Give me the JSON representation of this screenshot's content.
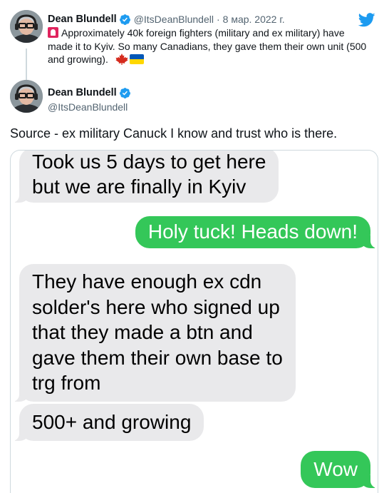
{
  "quoted_tweet": {
    "display_name": "Dean Blundell",
    "handle": "@ItsDeanBlundell",
    "separator": "·",
    "date": "8 мар. 2022 г.",
    "text": "Approximately 40k foreign fighters (military and ex military) have made it to Kyiv.  So many Canadians, they gave them their own unit (500 and growing).",
    "leading_emoji": "police-car-light-icon",
    "trailing_emojis": [
      "canada-maple-leaf-icon",
      "ukraine-flag-icon"
    ]
  },
  "main_tweet": {
    "display_name": "Dean Blundell",
    "handle": "@ItsDeanBlundell",
    "text": "Source - ex military Canuck I know and trust who is there."
  },
  "media": {
    "messages": [
      {
        "direction": "incoming",
        "lines": [
          "Took us 5 days to get here",
          "but we are finally in Kyiv"
        ]
      },
      {
        "direction": "outgoing",
        "lines": [
          "Holy tuck! Heads down!"
        ]
      },
      {
        "direction": "incoming",
        "lines": [
          "They have enough ex cdn",
          "solder's here who signed up",
          "that they made a btn and",
          "gave them their own base to",
          "trg from"
        ]
      },
      {
        "direction": "incoming",
        "lines": [
          "500+ and growing"
        ]
      },
      {
        "direction": "outgoing",
        "lines": [
          "Wow"
        ]
      }
    ]
  },
  "colors": {
    "verified_blue": "#1d9bf0",
    "twitter_blue": "#1d9bf0",
    "imessage_green": "#34c759",
    "incoming_gray": "#e9e9eb",
    "secondary_text": "#536471"
  }
}
